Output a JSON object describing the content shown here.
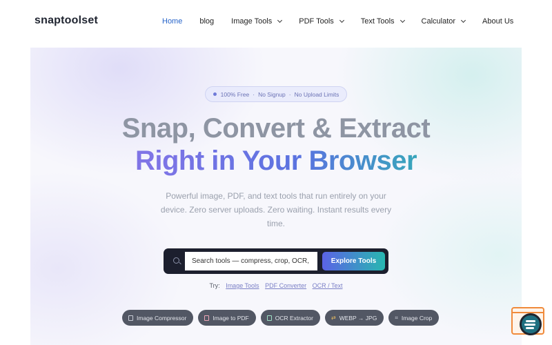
{
  "header": {
    "logo": "snaptoolset",
    "nav": [
      {
        "label": "Home",
        "active": true,
        "dropdown": false
      },
      {
        "label": "blog",
        "active": false,
        "dropdown": false
      },
      {
        "label": "Image Tools",
        "active": false,
        "dropdown": true
      },
      {
        "label": "PDF Tools",
        "active": false,
        "dropdown": true
      },
      {
        "label": "Text Tools",
        "active": false,
        "dropdown": true
      },
      {
        "label": "Calculator",
        "active": false,
        "dropdown": true
      },
      {
        "label": "About Us",
        "active": false,
        "dropdown": false
      }
    ]
  },
  "hero": {
    "badge": {
      "free": "100% Free",
      "sep": "·",
      "signup": "No Signup",
      "limits": "No Upload Limits"
    },
    "title_line1": "Snap, Convert & Extract",
    "title_line2": "Right in Your Browser",
    "subtitle": "Powerful image, PDF, and text tools that run entirely on your device. Zero server uploads. Zero waiting. Instant results every time.",
    "search": {
      "placeholder": "Search tools — compress, crop, OCR,",
      "button": "Explore Tools"
    },
    "try": {
      "label": "Try:",
      "links": [
        "Image Tools",
        "PDF Converter",
        "OCR / Text"
      ]
    },
    "pills": [
      {
        "label": "Image Compressor",
        "icon": "image-icon"
      },
      {
        "label": "Image to PDF",
        "icon": "pdf-file-icon"
      },
      {
        "label": "OCR Extractor",
        "icon": "ocr-icon"
      },
      {
        "label": "WEBP → JPG",
        "icon": "convert-icon"
      },
      {
        "label": "Image Crop",
        "icon": "crop-icon"
      }
    ]
  },
  "colors": {
    "nav_active": "#2563c9",
    "title_gray": "#8e95a3",
    "gradient_start": "#7f74e6",
    "gradient_end": "#2fb3b1",
    "search_bg": "#1c1f2e",
    "pill_bg": "#525764"
  }
}
